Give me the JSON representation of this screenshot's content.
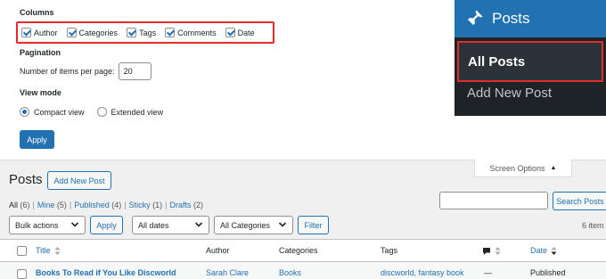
{
  "screen_options": {
    "columns_heading": "Columns",
    "columns": [
      {
        "label": "Author",
        "checked": true
      },
      {
        "label": "Categories",
        "checked": true
      },
      {
        "label": "Tags",
        "checked": true
      },
      {
        "label": "Comments",
        "checked": true
      },
      {
        "label": "Date",
        "checked": true
      }
    ],
    "pagination_heading": "Pagination",
    "per_page_label": "Number of items per page:",
    "per_page_value": "20",
    "view_mode_heading": "View mode",
    "view_modes": [
      {
        "label": "Compact view",
        "selected": true
      },
      {
        "label": "Extended view",
        "selected": false
      }
    ],
    "apply_label": "Apply",
    "tab_label": "Screen Options"
  },
  "admin_menu": {
    "section_title": "Posts",
    "icon": "pushpin-icon",
    "items": [
      {
        "label": "All Posts",
        "current": true
      },
      {
        "label": "Add New Post",
        "current": false
      }
    ]
  },
  "posts": {
    "title": "Posts",
    "add_new_label": "Add New Post",
    "filters": [
      {
        "label": "All",
        "count": "(6)"
      },
      {
        "label": "Mine",
        "count": "(5)"
      },
      {
        "label": "Published",
        "count": "(4)"
      },
      {
        "label": "Sticky",
        "count": "(1)"
      },
      {
        "label": "Drafts",
        "count": "(2)"
      }
    ],
    "search_button": "Search Posts",
    "bulk_actions": "Bulk actions",
    "bulk_apply": "Apply",
    "dates_select": "All dates",
    "categories_select": "All Categories",
    "filter_button": "Filter",
    "items_count": "6 item",
    "table": {
      "headers": {
        "title": "Title",
        "author": "Author",
        "categories": "Categories",
        "tags": "Tags",
        "comments_icon": "comment-bubble-icon",
        "date": "Date"
      },
      "rows": [
        {
          "title": "Books To Read if You Like Discworld",
          "author": "Sarah Clare",
          "categories": "Books",
          "tags": "discworld, fantasy book",
          "comments": "—",
          "date": "Published"
        }
      ]
    }
  },
  "colors": {
    "accent": "#2271b1",
    "highlight": "#e32b2b",
    "menu_bg": "#1d2327"
  }
}
